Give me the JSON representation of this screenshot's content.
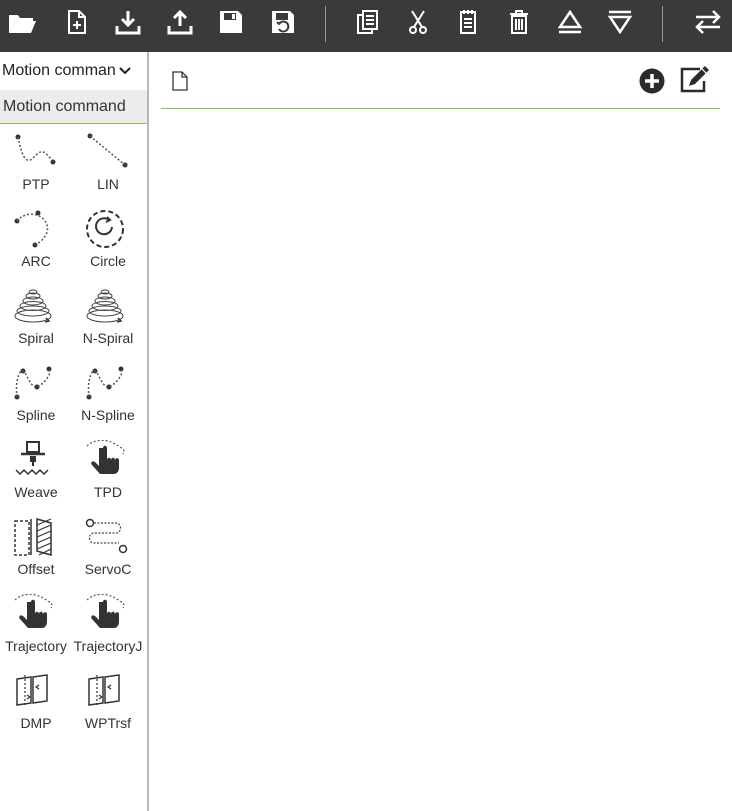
{
  "toolbar": {
    "buttons": [
      {
        "name": "open-folder-icon"
      },
      {
        "name": "new-file-icon"
      },
      {
        "name": "download-icon"
      },
      {
        "name": "upload-icon"
      },
      {
        "name": "save-icon"
      },
      {
        "name": "save-as-icon"
      },
      {
        "name": "copy-icon"
      },
      {
        "name": "cut-icon"
      },
      {
        "name": "paste-icon"
      },
      {
        "name": "delete-icon"
      },
      {
        "name": "move-up-icon"
      },
      {
        "name": "move-down-icon"
      },
      {
        "name": "swap-icon"
      }
    ]
  },
  "sidebar": {
    "category_select": "Motion command",
    "category_header": "Motion command",
    "tools": [
      {
        "label": "PTP",
        "icon": "ptp-icon"
      },
      {
        "label": "LIN",
        "icon": "lin-icon"
      },
      {
        "label": "ARC",
        "icon": "arc-icon"
      },
      {
        "label": "Circle",
        "icon": "circle-icon"
      },
      {
        "label": "Spiral",
        "icon": "spiral-icon"
      },
      {
        "label": "N-Spiral",
        "icon": "n-spiral-icon"
      },
      {
        "label": "Spline",
        "icon": "spline-icon"
      },
      {
        "label": "N-Spline",
        "icon": "n-spline-icon"
      },
      {
        "label": "Weave",
        "icon": "weave-icon"
      },
      {
        "label": "TPD",
        "icon": "tpd-icon"
      },
      {
        "label": "Offset",
        "icon": "offset-icon"
      },
      {
        "label": "ServoC",
        "icon": "servoc-icon"
      },
      {
        "label": "Trajectory",
        "icon": "trajectory-icon"
      },
      {
        "label": "TrajectoryJ",
        "icon": "trajectoryj-icon"
      },
      {
        "label": "DMP",
        "icon": "dmp-icon"
      },
      {
        "label": "WPTrsf",
        "icon": "wptrsf-icon"
      }
    ]
  },
  "colors": {
    "toolbar_bg": "#3a3a3a",
    "accent": "#8bc34a",
    "header_bg": "#ececec"
  }
}
